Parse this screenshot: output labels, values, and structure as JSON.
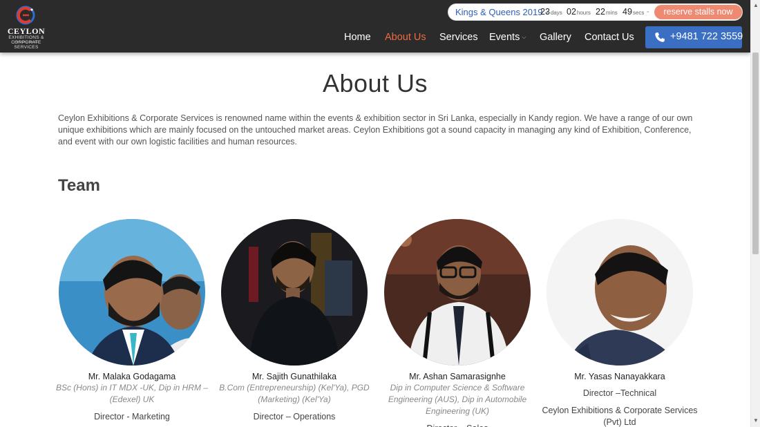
{
  "brand": {
    "name": "CEYLON",
    "sub": "EXHIBITIONS & CORPORATE SERVICES",
    "sub2": "(PRIVATE) LIMITED",
    "accent": "#ee6a43",
    "blue": "#3a6fc4"
  },
  "countdown": {
    "event": "Kings & Queens 2019 -",
    "days": "23",
    "days_label": "days",
    "hours": "02",
    "hours_label": "hours",
    "mins": "22",
    "mins_label": "mins",
    "secs": "49",
    "secs_label": "secs",
    "dash": "-",
    "cta": "reserve stalls now"
  },
  "nav": {
    "items": [
      "Home",
      "About Us",
      "Services",
      "Events",
      "Gallery",
      "Contact Us"
    ],
    "active": "About Us",
    "phone": "+9481 722 3559",
    "phone_icon": "phone-icon"
  },
  "page": {
    "title": "About Us",
    "intro": "Ceylon Exhibitions & Corporate Services is renowned name within the events & exhibition sector in Sri Lanka, especially in Kandy region. We have a range of our own unique exhibitions which are mainly focused on the untouched market areas. Ceylon Exhibitions got a sound capacity in managing any kind of Exhibition, Conference, and event with our own logistic facilities and human resources.",
    "team_heading": "Team"
  },
  "team": [
    {
      "name": "Mr. Malaka Godagama",
      "qualifications": "BSc (Hons) in IT MDX -UK, Dip in HRM – (Edexel) UK",
      "role": "Director - Marketing",
      "role2": ""
    },
    {
      "name": "Mr. Sajith Gunathilaka",
      "qualifications": "B.Com (Entrepreneurship) (Kel'Ya), PGD (Marketing) (Kel'Ya)",
      "role": "Director – Operations",
      "role2": ""
    },
    {
      "name": "Mr. Ashan Samarasignhe",
      "qualifications": "Dip in Computer Science & Software Engineering (AUS), Dip in Automobile Engineering (UK)",
      "role": "Director – Sales",
      "role2": ""
    },
    {
      "name": "Mr. Yasas Nanayakkara",
      "qualifications": "",
      "role": "Director –Technical",
      "role2": "Ceylon Exhibitions & Corporate Services (Pvt) Ltd"
    }
  ]
}
